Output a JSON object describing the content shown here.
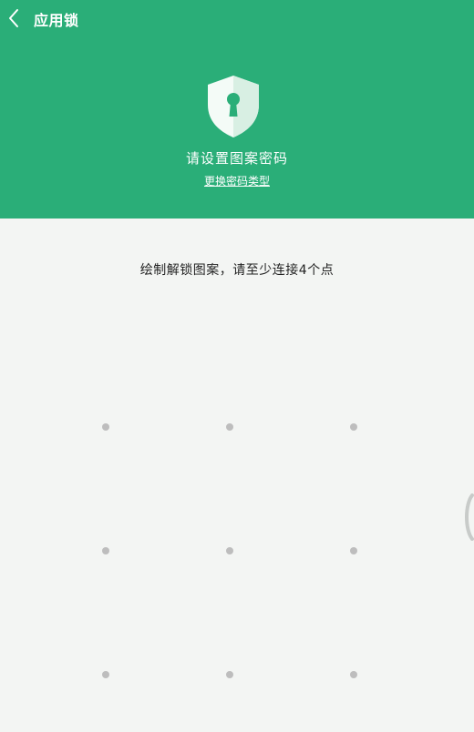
{
  "header": {
    "title": "应用锁",
    "back_icon": "chevron-left-icon",
    "lock_icon": "shield-keyhole-icon",
    "heading": "请设置图案密码",
    "change_type_link": "更换密码类型",
    "background_color": "#2aae78"
  },
  "pattern": {
    "instruction": "绘制解锁图案，请至少连接4个点",
    "dot_count": 9,
    "dot_color": "#bdbdbd"
  }
}
